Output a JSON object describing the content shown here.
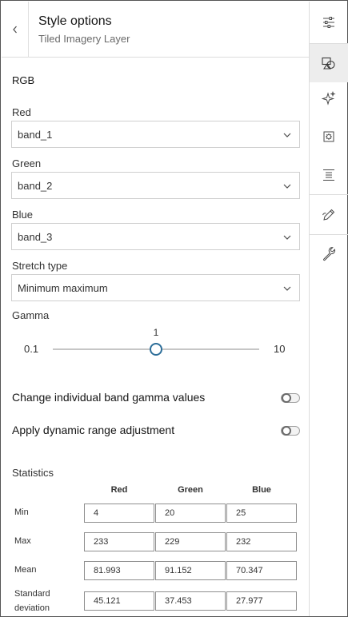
{
  "header": {
    "title": "Style options",
    "subtitle": "Tiled Imagery Layer"
  },
  "section_title": "RGB",
  "fields": {
    "red": {
      "label": "Red",
      "value": "band_1"
    },
    "green": {
      "label": "Green",
      "value": "band_2"
    },
    "blue": {
      "label": "Blue",
      "value": "band_3"
    },
    "stretch": {
      "label": "Stretch type",
      "value": "Minimum maximum"
    }
  },
  "gamma": {
    "label": "Gamma",
    "min": "0.1",
    "max": "10",
    "value": "1",
    "position_fraction": 0.5
  },
  "toggles": {
    "band_gamma": {
      "label": "Change individual band gamma values",
      "on": false
    },
    "dra": {
      "label": "Apply dynamic range adjustment",
      "on": false
    }
  },
  "statistics": {
    "title": "Statistics",
    "columns": [
      "Red",
      "Green",
      "Blue"
    ],
    "rows": [
      {
        "label": "Min",
        "values": [
          "4",
          "20",
          "25"
        ]
      },
      {
        "label": "Max",
        "values": [
          "233",
          "229",
          "232"
        ]
      },
      {
        "label": "Mean",
        "values": [
          "81.993",
          "91.152",
          "70.347"
        ]
      },
      {
        "label": "Standard deviation",
        "label_line1": "Standard",
        "label_line2": "deviation",
        "values": [
          "45.121",
          "37.453",
          "27.977"
        ]
      }
    ]
  },
  "actionbar": {
    "items": [
      {
        "icon": "sliders-icon",
        "active": false
      },
      {
        "icon": "shapes-icon",
        "active": true
      },
      {
        "icon": "sparkle-icon",
        "active": false
      },
      {
        "icon": "gear-box-icon",
        "active": false
      },
      {
        "icon": "list-icon",
        "active": false
      },
      {
        "icon": "pencil-icon",
        "active": false
      },
      {
        "icon": "wrench-icon",
        "active": false
      }
    ]
  },
  "colors": {
    "accent": "#2d6e99",
    "active_bg": "#ededed",
    "border": "#cfcfcf"
  }
}
